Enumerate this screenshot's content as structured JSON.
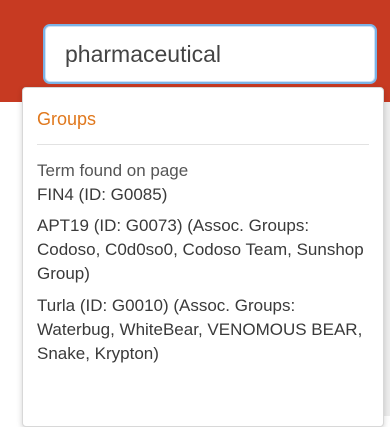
{
  "search": {
    "value": "pharmaceutical"
  },
  "dropdown": {
    "section_title": "Groups",
    "term_label": "Term found on page",
    "results": [
      {
        "label": "FIN4 (ID: G0085)"
      },
      {
        "label": "APT19 (ID: G0073) (Assoc. Groups: Codoso, C0d0so0, Codoso Team, Sunshop Group)"
      },
      {
        "label": "Turla (ID: G0010) (Assoc. Groups: Waterbug, WhiteBear, VENOMOUS BEAR, Snake, Krypton)"
      }
    ]
  },
  "colors": {
    "header": "#c73a22",
    "section_title": "#e0781d",
    "search_border": "#7cb4e6"
  }
}
